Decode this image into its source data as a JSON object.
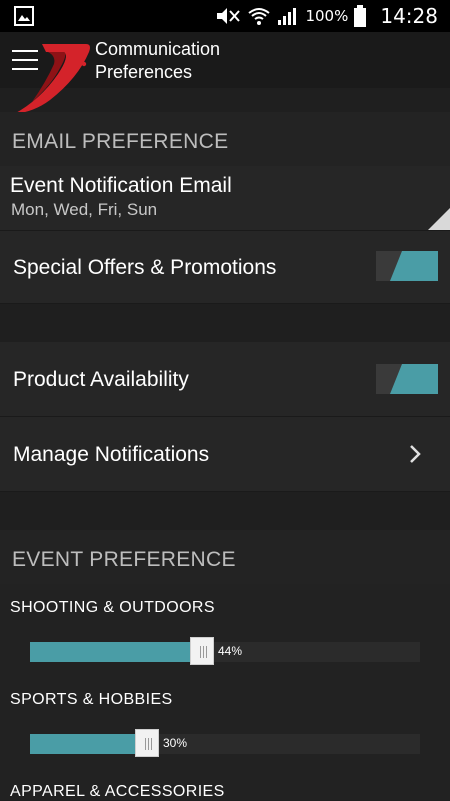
{
  "status_bar": {
    "battery_percent": "100%",
    "time": "14:28"
  },
  "app_bar": {
    "title_line1": "Communication",
    "title_line2": "Preferences"
  },
  "email_section": {
    "header": "EMAIL PREFERENCE",
    "event_notification": {
      "label": "Event Notification Email",
      "days": "Mon, Wed, Fri, Sun"
    },
    "special_offers": {
      "label": "Special Offers & Promotions",
      "enabled": true
    },
    "product_availability": {
      "label": "Product Availability",
      "enabled": true
    },
    "manage_notifications": {
      "label": "Manage Notifications"
    }
  },
  "event_section": {
    "header": "EVENT PREFERENCE",
    "items": [
      {
        "label": "SHOOTING & OUTDOORS",
        "value": 44,
        "value_text": "44%"
      },
      {
        "label": "SPORTS & HOBBIES",
        "value": 30,
        "value_text": "30%"
      },
      {
        "label": "APPAREL & ACCESSORIES"
      }
    ]
  },
  "colors": {
    "accent": "#4a9da6",
    "background": "#1f1f1f",
    "brand_red": "#d4232a"
  }
}
